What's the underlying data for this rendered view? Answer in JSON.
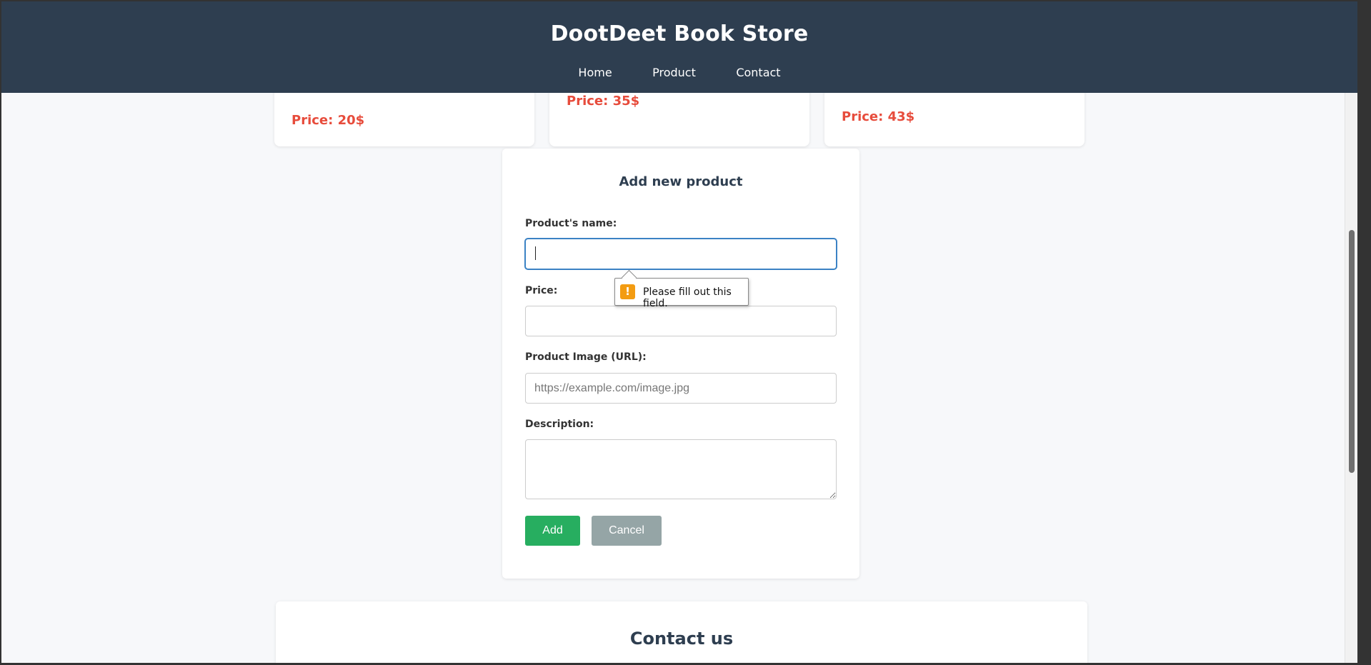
{
  "header": {
    "title": "DootDeet Book Store",
    "nav": [
      "Home",
      "Product",
      "Contact"
    ]
  },
  "cards": [
    {
      "price": "Price: 20$"
    },
    {
      "price": "Price: 35$"
    },
    {
      "price": "Price: 43$"
    }
  ],
  "form": {
    "title": "Add new product",
    "name_label": "Product's name:",
    "name_value": "",
    "price_label": "Price:",
    "price_value": "",
    "image_label": "Product Image (URL):",
    "image_placeholder": "https://example.com/image.jpg",
    "description_label": "Description:",
    "description_value": "",
    "add_label": "Add",
    "cancel_label": "Cancel"
  },
  "validation": {
    "icon": "warning-icon",
    "icon_glyph": "!",
    "message": "Please fill out this field."
  },
  "contact": {
    "title": "Contact us"
  },
  "colors": {
    "header_bg": "#2e3e50",
    "price": "#e74c3c",
    "add_button": "#27ae60",
    "cancel_button": "#95a5a6",
    "focus_border": "#3b82c4",
    "warning": "#f39c12"
  }
}
